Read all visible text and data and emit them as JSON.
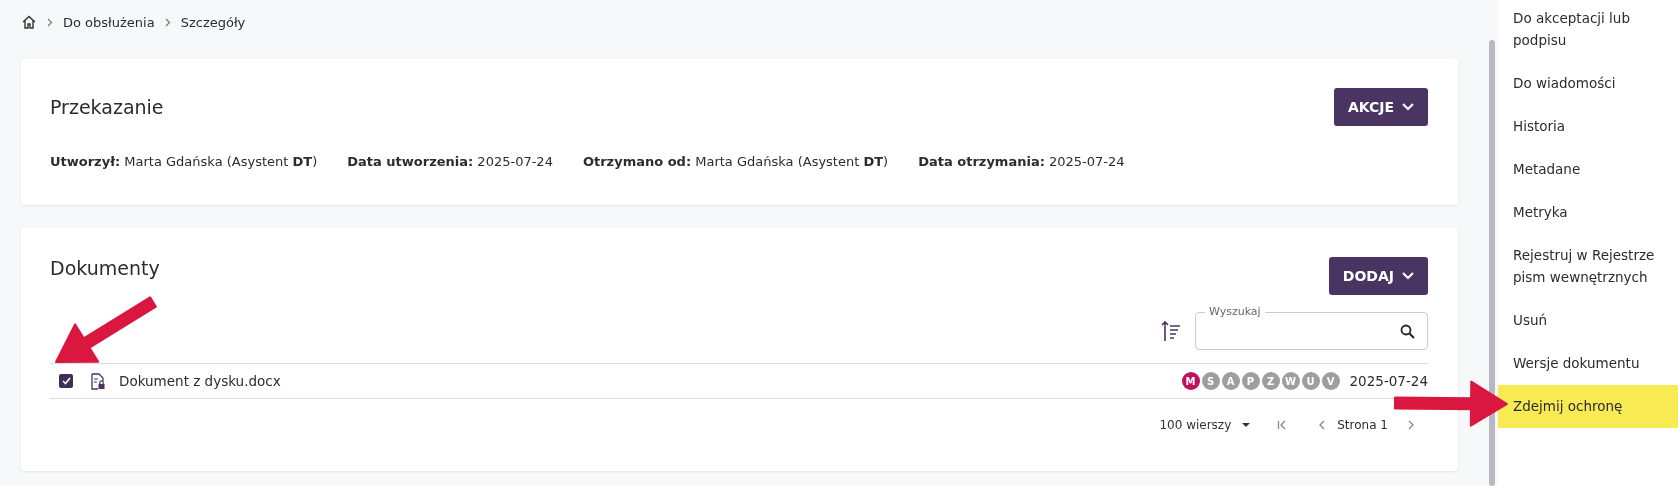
{
  "breadcrumb": {
    "items": [
      "Do obsłużenia",
      "Szczegóły"
    ]
  },
  "transfer_card": {
    "title": "Przekazanie",
    "action_button": "AKCJE",
    "meta": [
      "**Utworzył:** Marta Gdańska (Asystent **DT**)",
      "**Data utworzenia:** 2025-07-24",
      "**Otrzymano od:** Marta Gdańska (Asystent **DT**)",
      "**Data otrzymania:** 2025-07-24"
    ]
  },
  "documents_card": {
    "title": "Dokumenty",
    "add_button": "DODAJ",
    "search": {
      "label": "Wyszukaj"
    },
    "rows": [
      {
        "name": "Dokument z dysku.docx",
        "checked": true,
        "date": "2025-07-24",
        "badges": [
          {
            "letter": "M",
            "color": "#c2105f"
          },
          {
            "letter": "S",
            "color": "#9e9e9e"
          },
          {
            "letter": "A",
            "color": "#9e9e9e"
          },
          {
            "letter": "P",
            "color": "#9e9e9e"
          },
          {
            "letter": "Z",
            "color": "#9e9e9e"
          },
          {
            "letter": "W",
            "color": "#9e9e9e"
          },
          {
            "letter": "U",
            "color": "#9e9e9e"
          },
          {
            "letter": "V",
            "color": "#9e9e9e"
          }
        ]
      }
    ],
    "pagination": {
      "rows_per_page": "100 wierszy",
      "page": "Strona 1"
    }
  },
  "side_menu": {
    "items": [
      {
        "label": "Do akceptacji lub podpisu",
        "highlighted": false
      },
      {
        "label": "Do wiadomości",
        "highlighted": false
      },
      {
        "label": "Historia",
        "highlighted": false
      },
      {
        "label": "Metadane",
        "highlighted": false
      },
      {
        "label": "Metryka",
        "highlighted": false
      },
      {
        "label": "Rejestruj w Rejestrze pism wewnętrznych",
        "highlighted": false
      },
      {
        "label": "Usuń",
        "highlighted": false
      },
      {
        "label": "Wersje dokumentu",
        "highlighted": false
      },
      {
        "label": "Zdejmij ochronę",
        "highlighted": true
      }
    ]
  }
}
